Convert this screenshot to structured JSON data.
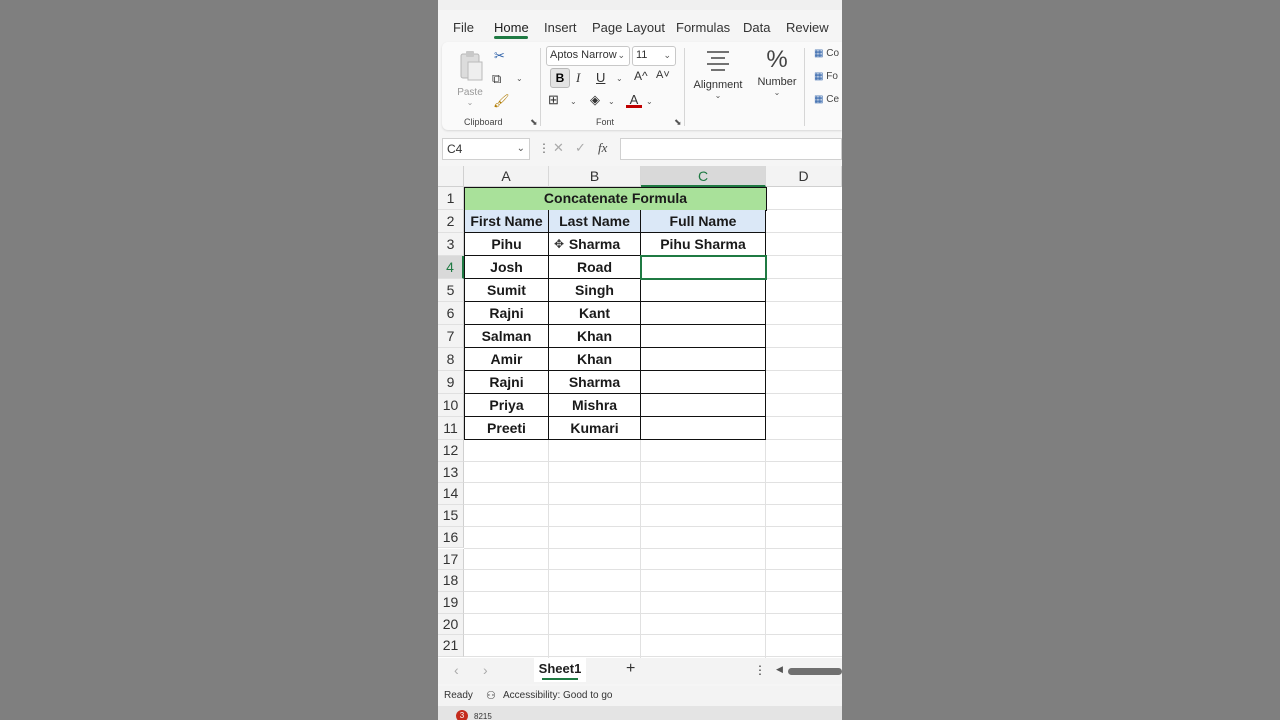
{
  "menu_tabs": [
    "File",
    "Home",
    "Insert",
    "Page Layout",
    "Formulas",
    "Data",
    "Review"
  ],
  "active_tab": "Home",
  "ribbon": {
    "paste_label": "Paste",
    "clipboard_label": "Clipboard",
    "font_name": "Aptos Narrow",
    "font_size": "11",
    "font_label": "Font",
    "bold": "B",
    "italic": "I",
    "underline": "U",
    "grow_font": "A^",
    "shrink_font": "A˅",
    "font_color_letter": "A",
    "alignment_label": "Alignment",
    "number_label": "Number",
    "percent_symbol": "%",
    "styles_partial": [
      "Co",
      "Fo",
      "Ce"
    ],
    "accent_color": "#1f7a43",
    "font_color": "#c00000"
  },
  "formula_bar": {
    "name_box": "C4",
    "fx": "fx",
    "content": ""
  },
  "sheet": {
    "columns": [
      "A",
      "B",
      "C",
      "D"
    ],
    "selected_column": "C",
    "row_numbers": [
      "1",
      "2",
      "3",
      "4",
      "5",
      "6",
      "7",
      "8",
      "9",
      "10",
      "11",
      "12",
      "13",
      "14",
      "15",
      "16",
      "17",
      "18",
      "19",
      "20",
      "21"
    ],
    "selected_row": "4",
    "title": "Concatenate Formula",
    "headers": [
      "First Name",
      "Last Name",
      "Full Name"
    ],
    "rows": [
      [
        "Pihu",
        "Sharma",
        "Pihu  Sharma"
      ],
      [
        "Josh",
        "Road",
        ""
      ],
      [
        "Sumit",
        "Singh",
        ""
      ],
      [
        "Rajni",
        "Kant",
        ""
      ],
      [
        "Salman",
        "Khan",
        ""
      ],
      [
        "Amir",
        "Khan",
        ""
      ],
      [
        "Rajni",
        "Sharma",
        ""
      ],
      [
        "Priya",
        "Mishra",
        ""
      ],
      [
        "Preeti",
        "Kumari",
        ""
      ]
    ],
    "title_fill": "#a9e19a",
    "header_fill": "#dbe8f7"
  },
  "sheet_tabs": {
    "active": "Sheet1",
    "add": "+"
  },
  "status": {
    "ready": "Ready",
    "accessibility": "Accessibility: Good to go"
  },
  "taskbar": {
    "badge": "3",
    "text": "8215"
  }
}
